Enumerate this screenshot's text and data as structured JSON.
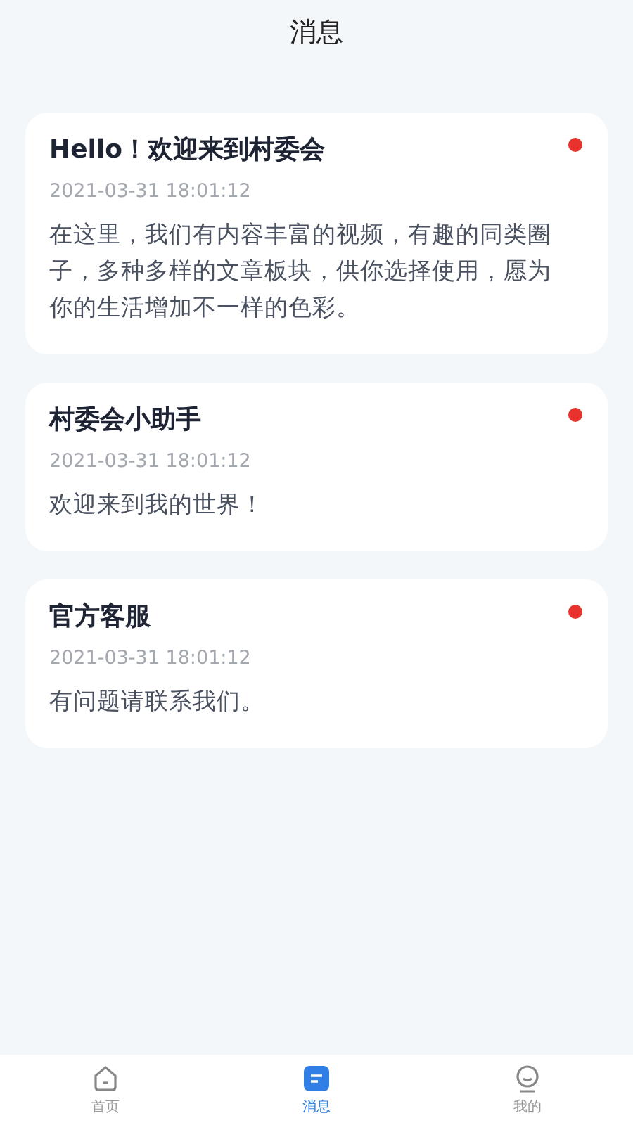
{
  "header": {
    "title": "消息"
  },
  "messages": [
    {
      "title": "Hello！欢迎来到村委会",
      "time": "2021-03-31 18:01:12",
      "body": "在这里，我们有内容丰富的视频，有趣的同类圈子，多种多样的文章板块，供你选择使用，愿为你的生活增加不一样的色彩。",
      "unread": true
    },
    {
      "title": "村委会小助手",
      "time": "2021-03-31 18:01:12",
      "body": "欢迎来到我的世界！",
      "unread": true
    },
    {
      "title": "官方客服",
      "time": "2021-03-31 18:01:12",
      "body": "有问题请联系我们。",
      "unread": true
    }
  ],
  "tabs": [
    {
      "kind": "home",
      "label": "首页",
      "selected": false
    },
    {
      "kind": "messages",
      "label": "消息",
      "selected": true
    },
    {
      "kind": "profile",
      "label": "我的",
      "selected": false
    }
  ]
}
